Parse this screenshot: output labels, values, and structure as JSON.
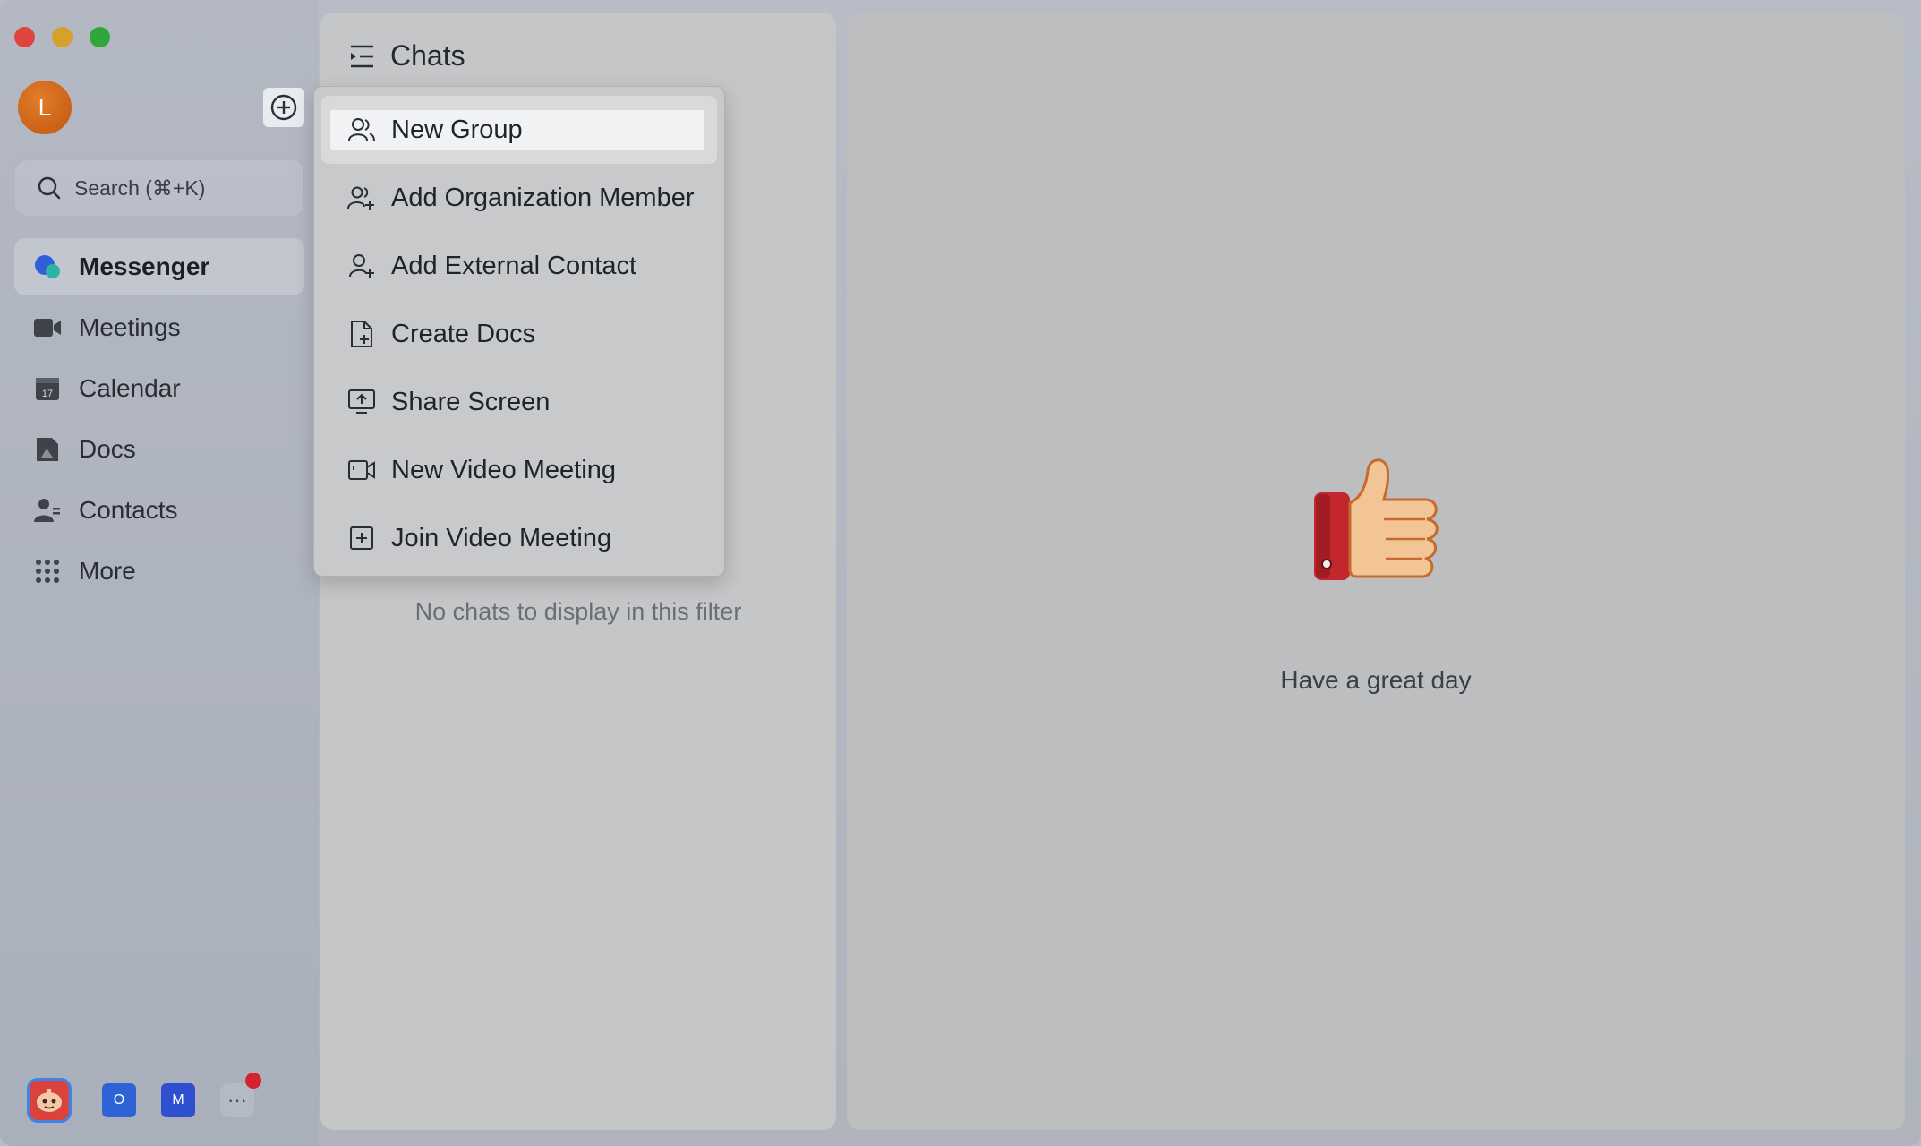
{
  "sidebar": {
    "avatar_initial": "L",
    "search_placeholder": "Search (⌘+K)",
    "nav": [
      {
        "label": "Messenger",
        "icon": "messenger-icon",
        "active": true
      },
      {
        "label": "Meetings",
        "icon": "video-camera-icon"
      },
      {
        "label": "Calendar",
        "icon": "calendar-icon",
        "badge": "17"
      },
      {
        "label": "Docs",
        "icon": "docs-icon"
      },
      {
        "label": "Contacts",
        "icon": "contacts-icon"
      },
      {
        "label": "More",
        "icon": "grid-dots-icon"
      }
    ],
    "dock": {
      "o_label": "O",
      "m_label": "M",
      "more_label": "···"
    }
  },
  "chats": {
    "title": "Chats",
    "empty_message": "No chats to display in this filter"
  },
  "main": {
    "message": "Have a great day"
  },
  "menu": {
    "items": [
      {
        "label": "New Group",
        "icon": "group-icon"
      },
      {
        "label": "Add Organization Member",
        "icon": "add-member-icon"
      },
      {
        "label": "Add External Contact",
        "icon": "add-contact-icon"
      },
      {
        "label": "Create Docs",
        "icon": "create-doc-icon"
      },
      {
        "label": "Share Screen",
        "icon": "share-screen-icon"
      },
      {
        "label": "New Video Meeting",
        "icon": "video-meeting-icon"
      },
      {
        "label": "Join Video Meeting",
        "icon": "join-meeting-icon"
      }
    ]
  },
  "colors": {
    "accent_blue": "#3d84e6",
    "avatar": "#c2560f",
    "badge_red": "#d4232d"
  }
}
